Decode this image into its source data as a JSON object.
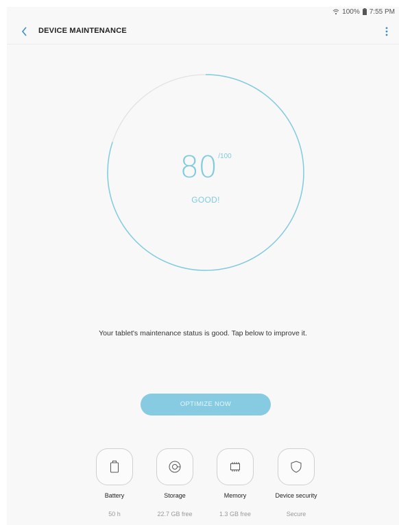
{
  "status_bar": {
    "battery": "100%",
    "time": "7:55 PM"
  },
  "header": {
    "title": "DEVICE MAINTENANCE"
  },
  "score": {
    "value": "80",
    "max": "/100",
    "status": "GOOD!",
    "fraction": 0.8,
    "accent_color": "#7fcbe0"
  },
  "message": "Your tablet's maintenance status is good. Tap below to improve it.",
  "optimize_button": {
    "label": "OPTIMIZE NOW",
    "color": "#86cbe1"
  },
  "categories": [
    {
      "icon": "battery-icon",
      "label": "Battery",
      "value": "50 h"
    },
    {
      "icon": "storage-icon",
      "label": "Storage",
      "value": "22.7 GB free"
    },
    {
      "icon": "memory-icon",
      "label": "Memory",
      "value": "1.3 GB free"
    },
    {
      "icon": "shield-icon",
      "label": "Device security",
      "value": "Secure"
    }
  ]
}
